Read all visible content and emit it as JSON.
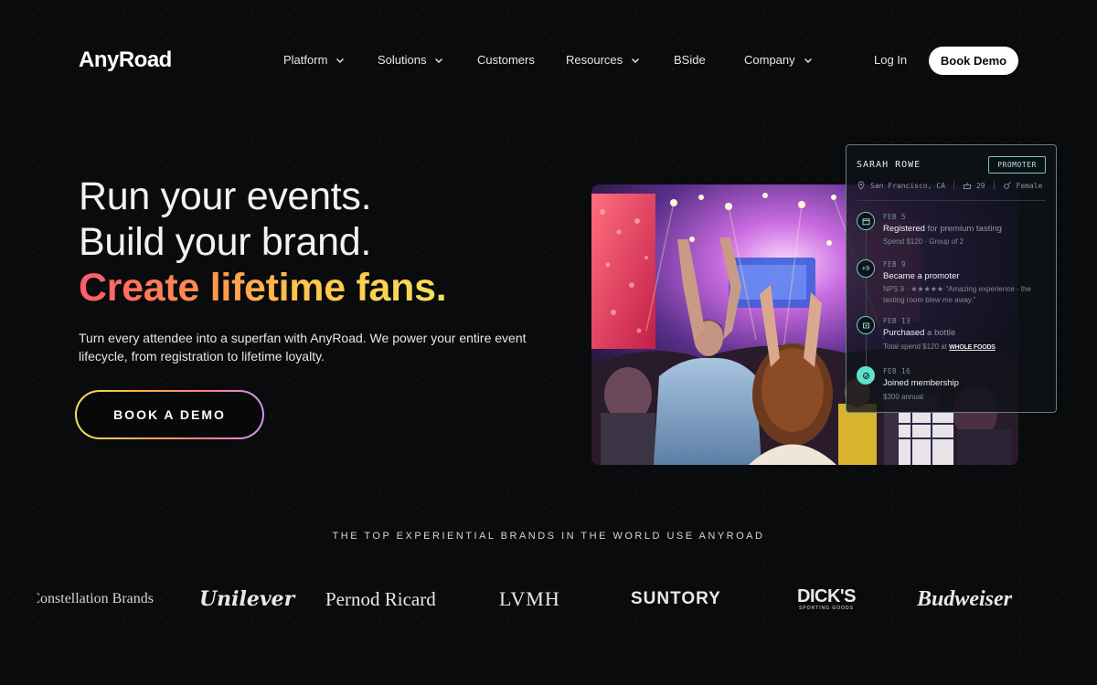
{
  "nav": {
    "logo": "AnyRoad",
    "items": [
      {
        "label": "Platform",
        "dropdown": true
      },
      {
        "label": "Solutions",
        "dropdown": true
      },
      {
        "label": "Customers",
        "dropdown": false
      },
      {
        "label": "Resources",
        "dropdown": true
      },
      {
        "label": "BSide",
        "dropdown": false
      },
      {
        "label": "Company",
        "dropdown": true
      }
    ],
    "login": "Log In",
    "book_demo": "Book Demo"
  },
  "hero": {
    "line1": "Run your events.",
    "line2": "Build your brand.",
    "line3": "Create lifetime fans.",
    "subtext": "Turn every attendee into a superfan with AnyRoad. We power your entire event lifecycle, from registration to lifetime loyalty.",
    "cta": "BOOK A DEMO"
  },
  "profile_card": {
    "name": "SARAH ROWE",
    "badge": "PROMOTER",
    "location": "San Francisco, CA",
    "age": "29",
    "gender": "Female",
    "events": [
      {
        "date": "FEB 5",
        "title_bold": "Registered",
        "title_rest": " for premium tasting",
        "detail": "Spend $120 · Group of 2",
        "icon": "calendar-icon"
      },
      {
        "date": "FEB 9",
        "title_bold": "Became a promoter",
        "title_rest": "",
        "detail": "NPS 9 · ★★★★★ \"Amazing experience - the tasting room blew me away.\"",
        "icon": "plus-nine-icon",
        "node_label": "+9"
      },
      {
        "date": "FEB 13",
        "title_bold": "Purchased",
        "title_rest": " a bottle",
        "detail": "Total spend $120 at",
        "store": "WHOLE FOODS",
        "icon": "cart-icon"
      },
      {
        "date": "FEB 16",
        "title_bold": "Joined membership",
        "title_rest": "",
        "detail": "$300 annual",
        "icon": "check-icon"
      }
    ]
  },
  "brands": {
    "title": "THE TOP EXPERIENTIAL BRANDS IN THE WORLD USE ANYROAD",
    "logos": [
      "Constellation Brands",
      "Unilever",
      "Pernod Ricard",
      "LVMH",
      "SUNTORY",
      "DICK'S",
      "Budweiser"
    ],
    "dicks_sub": "SPORTING GOODS"
  },
  "colors": {
    "background": "#0a0b0d",
    "gradient_start": "#ff5a6e",
    "gradient_end": "#f6de5b",
    "card_accent": "#5ee2cf"
  }
}
